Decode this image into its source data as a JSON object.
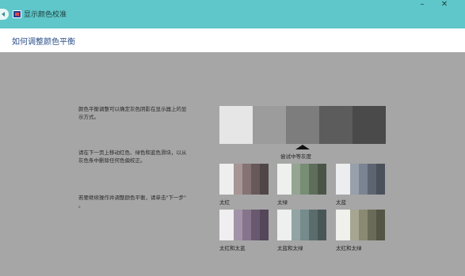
{
  "window": {
    "title": "显示颜色校准",
    "minimize": "–",
    "close": "✕"
  },
  "header": {
    "title": "如何调整颜色平衡"
  },
  "instructions": {
    "p1_line1": "颜色平衡调整可以确定灰色阴影在显示器上的显",
    "p1_line2": "示方式。",
    "p2_line1": "请在下一页上移动红色、绿色和蓝色滑块，以从",
    "p2_line2": "灰色条中删除任何色偏校正。",
    "p3_line1": "若要继续操作并调整颜色平衡，请单击\"下一步\"",
    "p3_line2": "。"
  },
  "gray_reference": {
    "caption": "尝试中等灰度",
    "colors": [
      "#e6e6e6",
      "#9c9c9c",
      "#7d7d7d",
      "#5c5c5c",
      "#4a4a4a"
    ]
  },
  "samples": [
    {
      "label": "太红",
      "colors": [
        "#eeeeee",
        "#a89596",
        "#857273",
        "#675859",
        "#514647"
      ]
    },
    {
      "label": "太绿",
      "colors": [
        "#eef0ee",
        "#94a592",
        "#778d74",
        "#5e6e5b",
        "#4a5548"
      ]
    },
    {
      "label": "太蓝",
      "colors": [
        "#ecedef",
        "#97a0ab",
        "#7a8492",
        "#5e6572",
        "#4b515b"
      ]
    },
    {
      "label": "太红和太蓝",
      "colors": [
        "#f0eef0",
        "#a293a8",
        "#86748d",
        "#68596e",
        "#544759"
      ]
    },
    {
      "label": "太蓝和太绿",
      "colors": [
        "#eef0f0",
        "#92a4a4",
        "#758b8c",
        "#5b6c6d",
        "#485657"
      ]
    },
    {
      "label": "太红和太绿",
      "colors": [
        "#f0f0ec",
        "#a5a592",
        "#8a8a73",
        "#6b6b59",
        "#555546"
      ]
    }
  ]
}
